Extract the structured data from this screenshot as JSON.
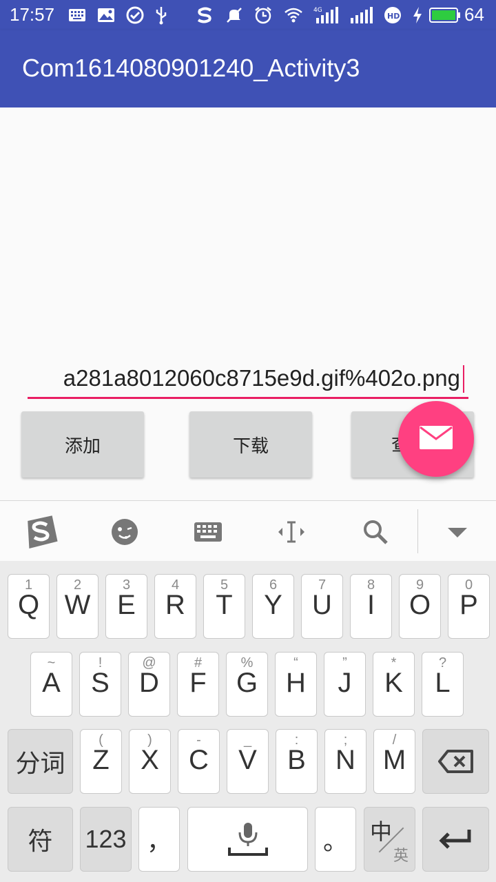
{
  "status_bar": {
    "time": "17:57",
    "battery_level": "64",
    "icons": [
      "keyboard-icon",
      "image-icon",
      "check-icon",
      "usb-icon",
      "sogou-icon",
      "mute-icon",
      "alarm-icon",
      "wifi-icon",
      "signal-4g-icon",
      "signal-icon",
      "hd-icon",
      "charging-icon",
      "battery-icon"
    ]
  },
  "app_bar": {
    "title": "Com1614080901240_Activity3"
  },
  "input": {
    "value": "a281a8012060c8715e9d.gif%402o.png"
  },
  "buttons": {
    "add": "添加",
    "download": "下载",
    "third_partial": "查"
  },
  "colors": {
    "primary": "#3f51b5",
    "accent": "#ff4081",
    "button_bg": "#d6d7d7"
  },
  "keyboard": {
    "toolbar_icons": [
      "sogou-logo-icon",
      "emoji-icon",
      "keyboard-icon",
      "cursor-move-icon",
      "search-icon",
      "collapse-icon"
    ],
    "row1": [
      {
        "main": "Q",
        "hint": "1"
      },
      {
        "main": "W",
        "hint": "2"
      },
      {
        "main": "E",
        "hint": "3"
      },
      {
        "main": "R",
        "hint": "4"
      },
      {
        "main": "T",
        "hint": "5"
      },
      {
        "main": "Y",
        "hint": "6"
      },
      {
        "main": "U",
        "hint": "7"
      },
      {
        "main": "I",
        "hint": "8"
      },
      {
        "main": "O",
        "hint": "9"
      },
      {
        "main": "P",
        "hint": "0"
      }
    ],
    "row2": [
      {
        "main": "A",
        "hint": "~"
      },
      {
        "main": "S",
        "hint": "!"
      },
      {
        "main": "D",
        "hint": "@"
      },
      {
        "main": "F",
        "hint": "#"
      },
      {
        "main": "G",
        "hint": "%"
      },
      {
        "main": "H",
        "hint": "“"
      },
      {
        "main": "J",
        "hint": "”"
      },
      {
        "main": "K",
        "hint": "*"
      },
      {
        "main": "L",
        "hint": "?"
      }
    ],
    "row3": [
      {
        "main": "Z",
        "hint": "("
      },
      {
        "main": "X",
        "hint": ")"
      },
      {
        "main": "C",
        "hint": "-"
      },
      {
        "main": "V",
        "hint": "_"
      },
      {
        "main": "B",
        "hint": ":"
      },
      {
        "main": "N",
        "hint": ";"
      },
      {
        "main": "M",
        "hint": "/"
      }
    ],
    "fenci": "分词",
    "fu": "符",
    "num": "123",
    "comma": "，",
    "period": "。",
    "zh": "中",
    "en": "英"
  }
}
